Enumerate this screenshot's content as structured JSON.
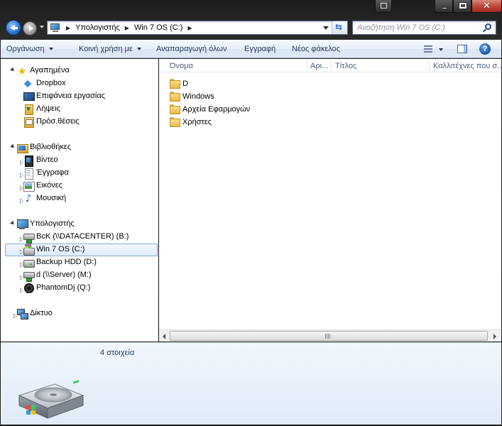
{
  "window": {
    "title_buttons": {
      "minimize": "minimize",
      "maximize": "maximize",
      "close": "✕"
    }
  },
  "address": {
    "crumbs": [
      "Υπολογιστής",
      "Win 7 OS (C:)"
    ],
    "search_placeholder": "Αναζήτηση Win 7 OS (C:)"
  },
  "toolbar": {
    "organize": "Οργάνωση",
    "share": "Κοινή χρήση με",
    "play_all": "Αναπαραγωγή όλων",
    "burn": "Εγγραφή",
    "new_folder": "Νέος φάκελος",
    "help": "?"
  },
  "nav": {
    "favorites": {
      "label": "Αγαπημένα",
      "items": [
        "Dropbox",
        "Επιφάνεια εργασίας",
        "Λήψεις",
        "Πρόσ.θέσεις"
      ]
    },
    "libraries": {
      "label": "Βιβλιοθήκες",
      "items": [
        "Βίντεο",
        "Έγγραφα",
        "Εικόνες",
        "Μουσική"
      ]
    },
    "computer": {
      "label": "Υπολογιστής",
      "items": [
        "BcK (\\\\DATACENTER) (B:)",
        "Win 7 OS (C:)",
        "Backup HDD (D:)",
        "d (\\\\Server) (M:)",
        "PhantomDj (Q:)"
      ]
    },
    "network": {
      "label": "Δίκτυο"
    }
  },
  "columns": [
    "Όνομα",
    "Αρι...",
    "Τίτλος",
    "Καλλιτέχνες που σ..."
  ],
  "files": [
    "D",
    "Windows",
    "Αρχεία Εφαρμογών",
    "Χρήστες"
  ],
  "details": {
    "count": "4 στοιχεία"
  },
  "colors": {
    "accent": "#1e395b",
    "selection_border": "#84acdd",
    "close_red": "#c0453a"
  }
}
